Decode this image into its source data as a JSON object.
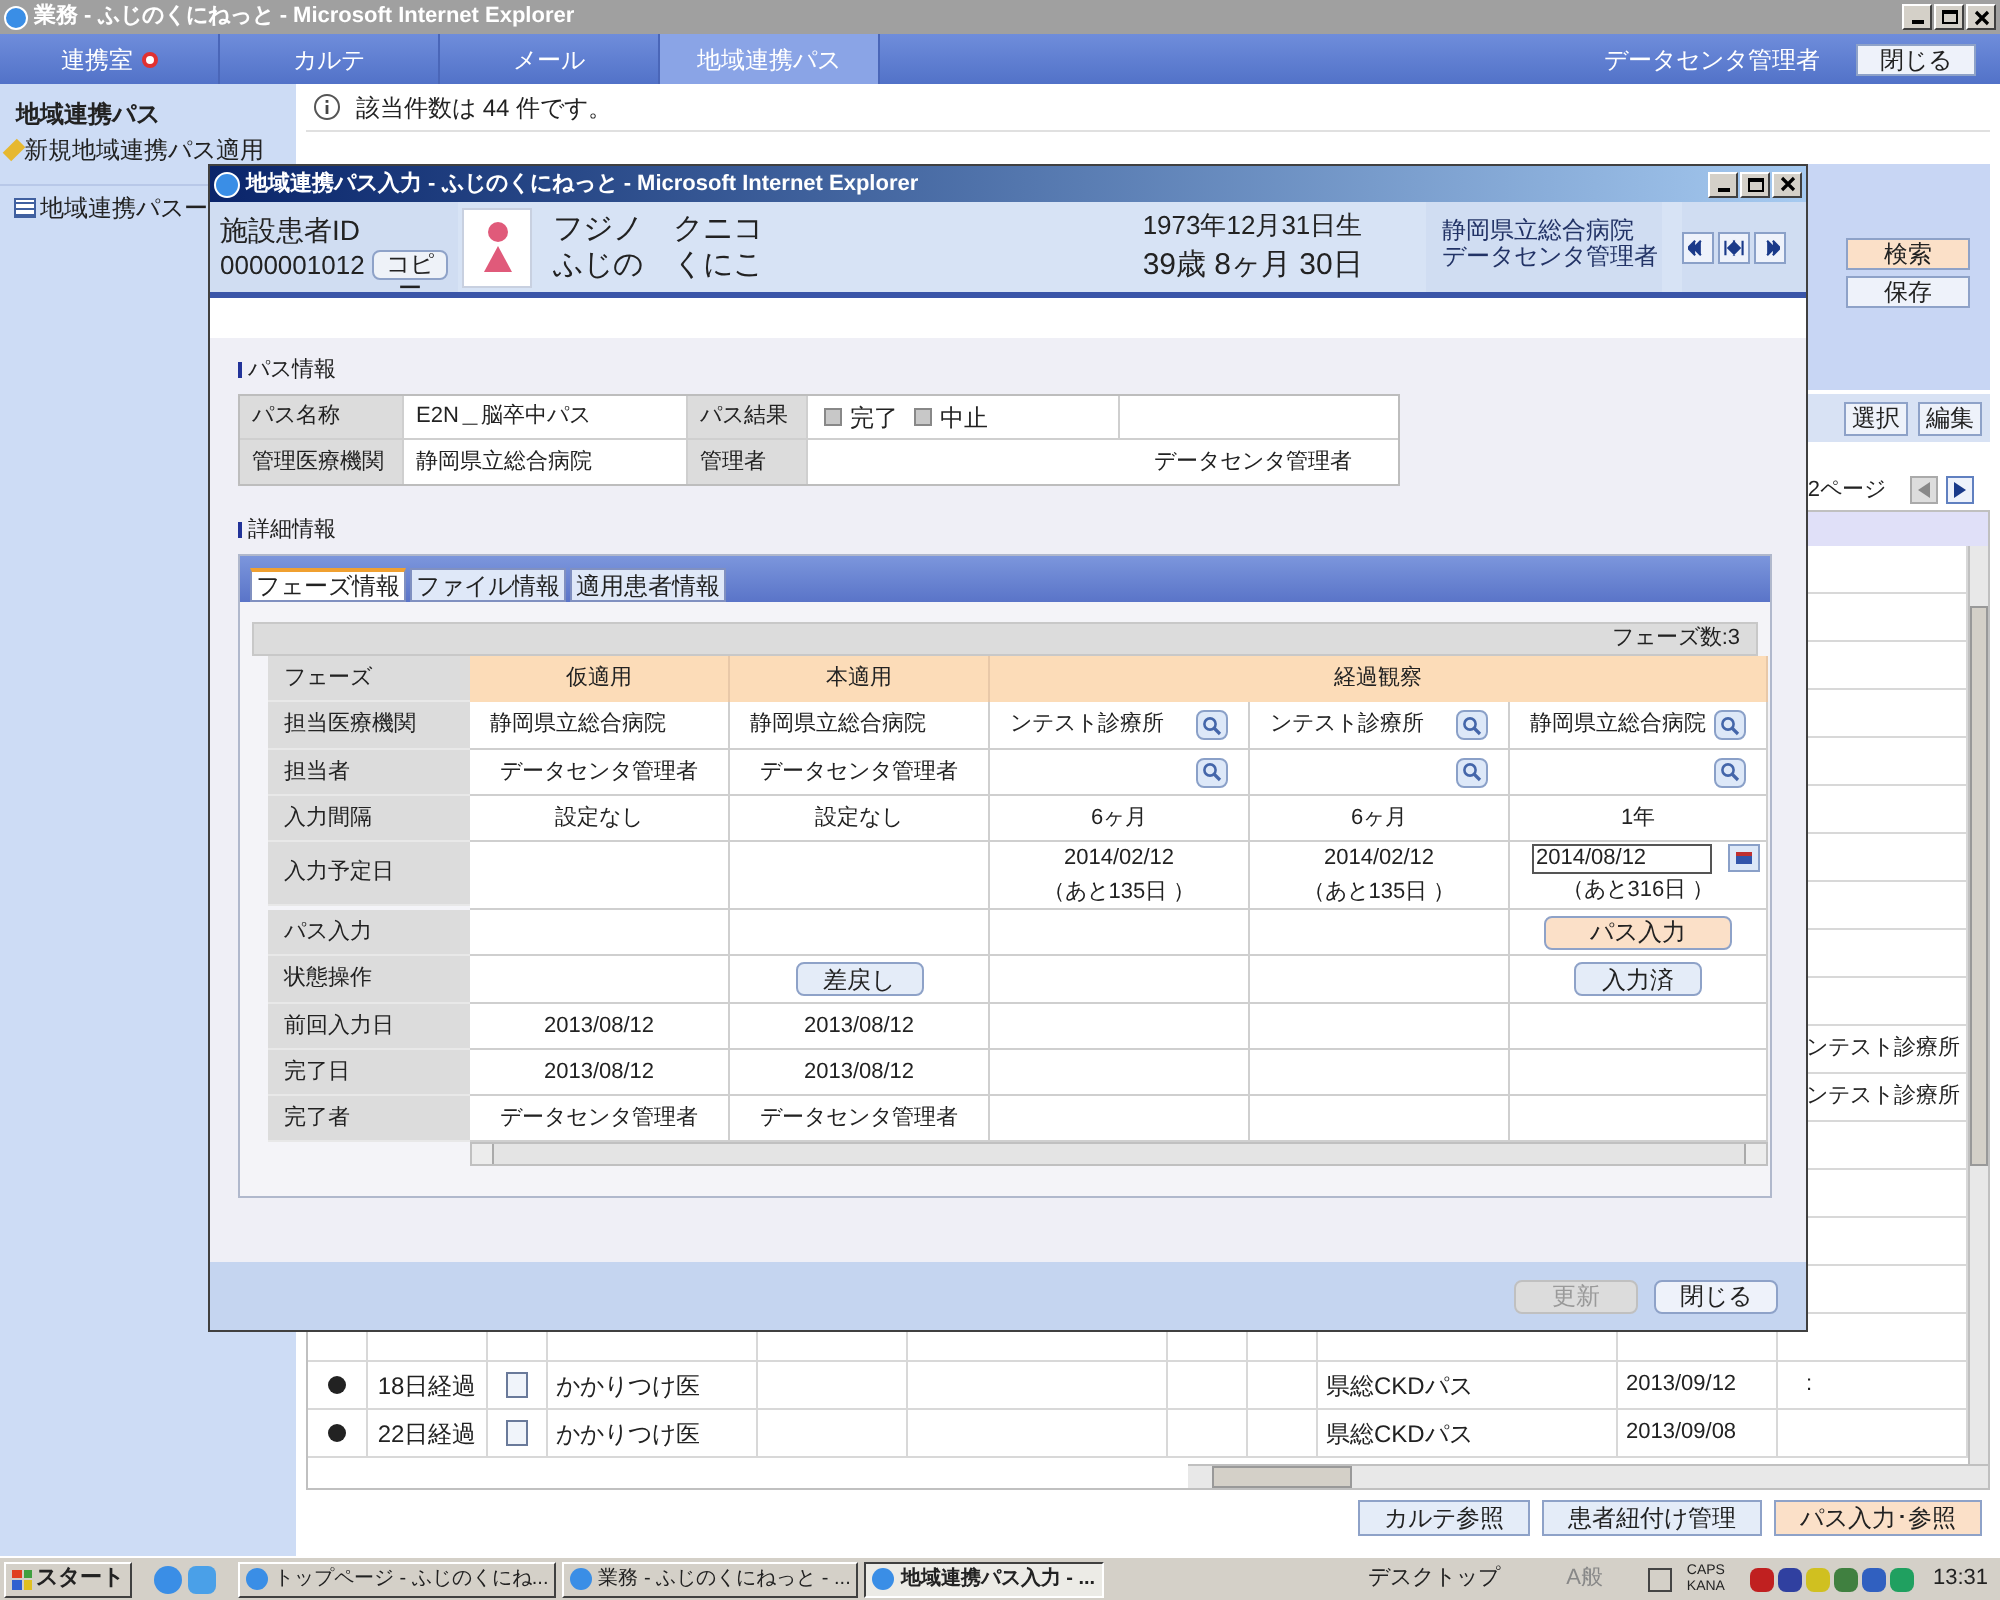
{
  "window": {
    "title": "業務 - ふじのくにねっと - Microsoft Internet Explorer"
  },
  "nav": {
    "tabs": [
      {
        "label": "連携室",
        "alert": true,
        "selected": false
      },
      {
        "label": "カルテ",
        "alert": false,
        "selected": false
      },
      {
        "label": "メール",
        "alert": false,
        "selected": false
      },
      {
        "label": "地域連携パス",
        "alert": false,
        "selected": true
      }
    ],
    "user": "データセンタ管理者",
    "close_button": "閉じる"
  },
  "sidebar": {
    "title": "地域連携パス",
    "items": [
      {
        "label": "新規地域連携パス適用",
        "kind": "action"
      },
      {
        "label": "地域連携パスー",
        "kind": "list"
      }
    ]
  },
  "info": "該当件数は 44 件です。",
  "search_panel": {
    "buttons": [
      {
        "label": "検索",
        "highlighted": true
      },
      {
        "label": "保存",
        "highlighted": false
      }
    ]
  },
  "list_toolbar": {
    "buttons": [
      "選択",
      "編集"
    ],
    "pager": "2ページ"
  },
  "list": {
    "rows": [
      {},
      {},
      {},
      {},
      {},
      {},
      {},
      {},
      {},
      {},
      {
        "column_11": "ンテスト診療所"
      },
      {
        "column_11": "ンテスト診療所"
      },
      {},
      {},
      {},
      {},
      {},
      {
        "status": true,
        "elapsed": "18日経過",
        "role": "かかりつけ医",
        "path": "県総CKDパス",
        "date": "2013/09/12",
        "column_11": ":"
      },
      {
        "status": true,
        "elapsed": "22日経過",
        "role": "かかりつけ医",
        "path": "県総CKDパス",
        "date": "2013/09/08"
      }
    ]
  },
  "bottom_buttons": [
    {
      "label": "カルテ参照",
      "highlighted": false
    },
    {
      "label": "患者紐付け管理",
      "highlighted": false
    },
    {
      "label": "パス入力･参照",
      "highlighted": true
    }
  ],
  "popup": {
    "title": "地域連携パス入力 - ふじのくにねっと - Microsoft Internet Explorer",
    "patient": {
      "id_label": "施設患者ID",
      "id": "0000001012",
      "copy_button": "コピー",
      "name_kana": "フジノ　クニコ",
      "name": "ふじの　くにこ",
      "birth": "1973年12月31日生",
      "age": "39歳 8ヶ月 30日",
      "hospital": "静岡県立総合病院",
      "user": "データセンタ管理者"
    },
    "path_info": {
      "heading": "パス情報",
      "name_label": "パス名称",
      "name": "E2N＿脳卒中パス",
      "result_label": "パス結果",
      "results": [
        {
          "label": "完了",
          "checked": false
        },
        {
          "label": "中止",
          "checked": false
        }
      ],
      "org_label": "管理医療機関",
      "org": "静岡県立総合病院",
      "manager_label": "管理者",
      "manager": "データセンタ管理者"
    },
    "detail": {
      "heading": "詳細情報",
      "tabs": [
        {
          "label": "フェーズ情報",
          "selected": true
        },
        {
          "label": "ファイル情報",
          "selected": false
        },
        {
          "label": "適用患者情報",
          "selected": false
        }
      ],
      "phase_count": "フェーズ数:3",
      "row_labels": [
        "フェーズ",
        "担当医療機関",
        "担当者",
        "入力間隔",
        "入力予定日",
        "パス入力",
        "状態操作",
        "前回入力日",
        "完了日",
        "完了者"
      ],
      "phases": [
        {
          "label": "仮適用",
          "columns": [
            {
              "hospital": "静岡県立総合病院",
              "person": "データセンタ管理者",
              "interval": "設定なし",
              "last_input": "2013/08/12",
              "completed": "2013/08/12",
              "completed_by": "データセンタ管理者"
            }
          ]
        },
        {
          "label": "本適用",
          "columns": [
            {
              "hospital": "静岡県立総合病院",
              "person": "データセンタ管理者",
              "interval": "設定なし",
              "state_button": "差戻し",
              "last_input": "2013/08/12",
              "completed": "2013/08/12",
              "completed_by": "データセンタ管理者"
            }
          ]
        },
        {
          "label": "経過観察",
          "columns": [
            {
              "hospital": "ンテスト診療所",
              "lookup": true,
              "interval": "6ヶ月",
              "editable": false,
              "due_date": "2014/02/12",
              "remaining": "（あと135日 ）"
            },
            {
              "hospital": "ンテスト診療所",
              "lookup": true,
              "interval": "6ヶ月",
              "editable": false,
              "due_date": "2014/02/12",
              "remaining": "（あと135日 ）"
            },
            {
              "hospital": "静岡県立総合病院",
              "lookup": true,
              "interval": "1年",
              "editable": true,
              "due_date": "2014/08/12",
              "remaining": "（あと316日 ）",
              "path_button": "パス入力",
              "state_button": "入力済"
            }
          ]
        }
      ]
    },
    "footer_buttons": [
      {
        "label": "更新",
        "disabled": true
      },
      {
        "label": "閉じる",
        "disabled": false
      }
    ]
  },
  "taskbar": {
    "start": "スタート",
    "windows": [
      {
        "label": "トップページ - ふじのくにね...",
        "selected": false
      },
      {
        "label": "業務 - ふじのくにねっと - ...",
        "selected": false
      },
      {
        "label": "地域連携パス入力 - ...",
        "selected": true
      }
    ],
    "desktop": "デスクトップ",
    "ime": "A般",
    "caps": "CAPS",
    "kana": "KANA",
    "clock": "13:31"
  }
}
